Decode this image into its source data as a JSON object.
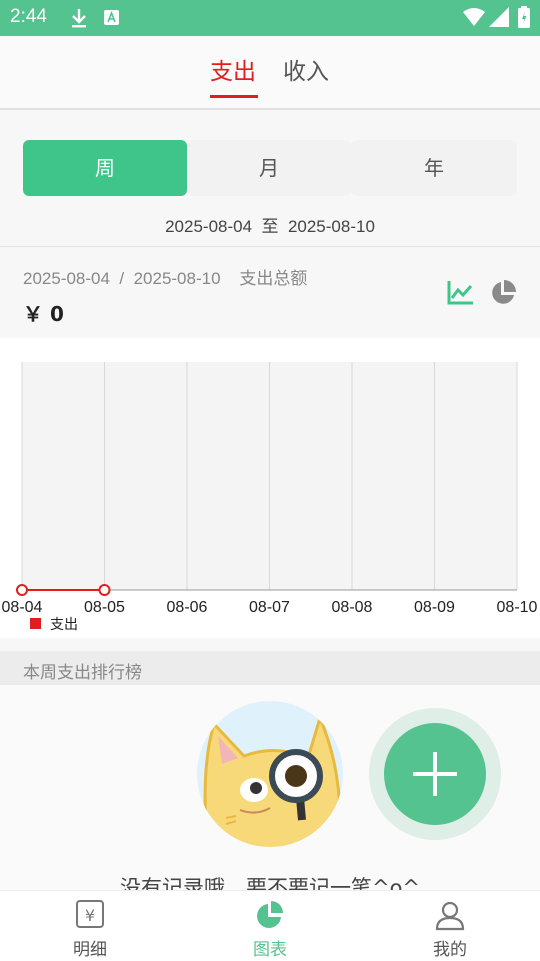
{
  "status_bar": {
    "time": "2:44"
  },
  "top_tabs": {
    "expense": "支出",
    "income": "收入"
  },
  "period": {
    "week": "周",
    "month": "月",
    "year": "年"
  },
  "range": {
    "text": "2025-08-04  至  2025-08-10"
  },
  "summary": {
    "label": "2025-08-04  /  2025-08-10    支出总额",
    "total": "￥ 0"
  },
  "chart_data": {
    "type": "line",
    "categories": [
      "08-04",
      "08-05",
      "08-06",
      "08-07",
      "08-08",
      "08-09",
      "08-10"
    ],
    "series": [
      {
        "name": "支出",
        "values": [
          0,
          0
        ]
      }
    ],
    "legend_position": "bottom-left",
    "grid": true,
    "colors": {
      "series": "#e21d1d"
    }
  },
  "ranking": {
    "title": "本周支出排行榜",
    "empty_text": "没有记录哦，要不要记一笔^o^"
  },
  "bottom_nav": {
    "detail": "明细",
    "chart": "图表",
    "mine": "我的"
  },
  "colors": {
    "accent": "#3fc58a",
    "expense_red": "#e21d1d",
    "status_bar": "#55c38f"
  }
}
